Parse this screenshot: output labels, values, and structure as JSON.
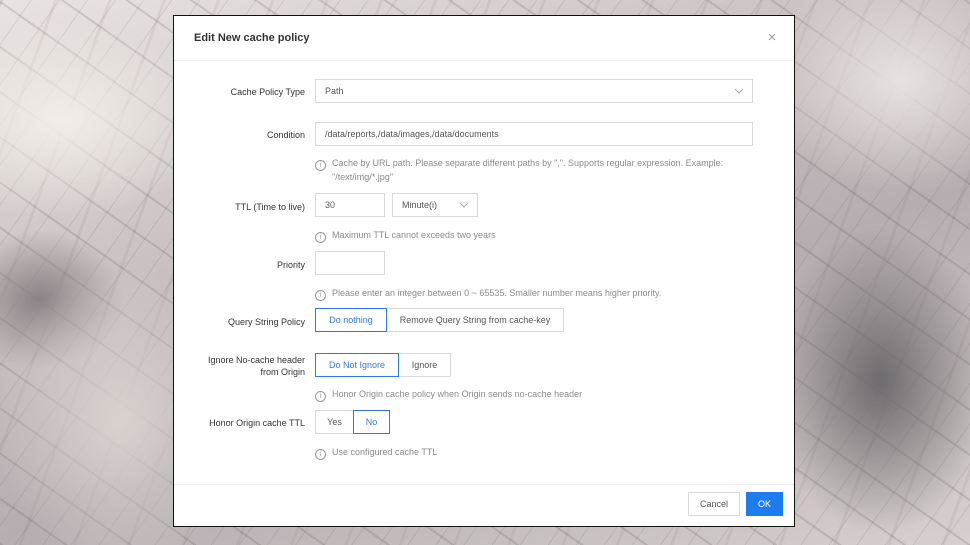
{
  "dialog": {
    "title": "Edit New cache policy",
    "close_icon": "×"
  },
  "form": {
    "policy_type": {
      "label": "Cache Policy Type",
      "value": "Path"
    },
    "condition": {
      "label": "Condition",
      "value": "/data/reports,/data/images,/data/documents",
      "hint_line1": "Cache by URL path. Please separate different paths by \",\". Supports regular expression. Example:",
      "hint_line2": "\"/text/img/*.jpg\""
    },
    "ttl": {
      "label": "TTL (Time to live)",
      "value": "30",
      "unit": "Minute(i)",
      "hint": "Maximum TTL cannot exceeds two years"
    },
    "priority": {
      "label": "Priority",
      "value": "",
      "hint": "Please enter an integer between 0 ~ 65535. Smaller number means higher priority."
    },
    "query_string": {
      "label": "Query String Policy",
      "options": [
        "Do nothing",
        "Remove Query String from cache-key"
      ],
      "selected": "Do nothing"
    },
    "ignore_nocache": {
      "label_line1": "Ignore No-cache header",
      "label_line2": "from Origin",
      "options": [
        "Do Not Ignore",
        "Ignore"
      ],
      "selected": "Do Not Ignore",
      "hint": "Honor Origin cache policy when Origin sends no-cache header"
    },
    "honor_ttl": {
      "label": "Honor Origin cache TTL",
      "options": [
        "Yes",
        "No"
      ],
      "selected": "No",
      "hint": "Use configured cache TTL"
    }
  },
  "footer": {
    "cancel_label": "Cancel",
    "ok_label": "OK"
  },
  "colors": {
    "accent": "#2f7be5",
    "primary_button": "#1c7cf0"
  },
  "icons": {
    "info": "info-circle-icon",
    "chevron": "chevron-down-icon",
    "close": "close-icon"
  }
}
